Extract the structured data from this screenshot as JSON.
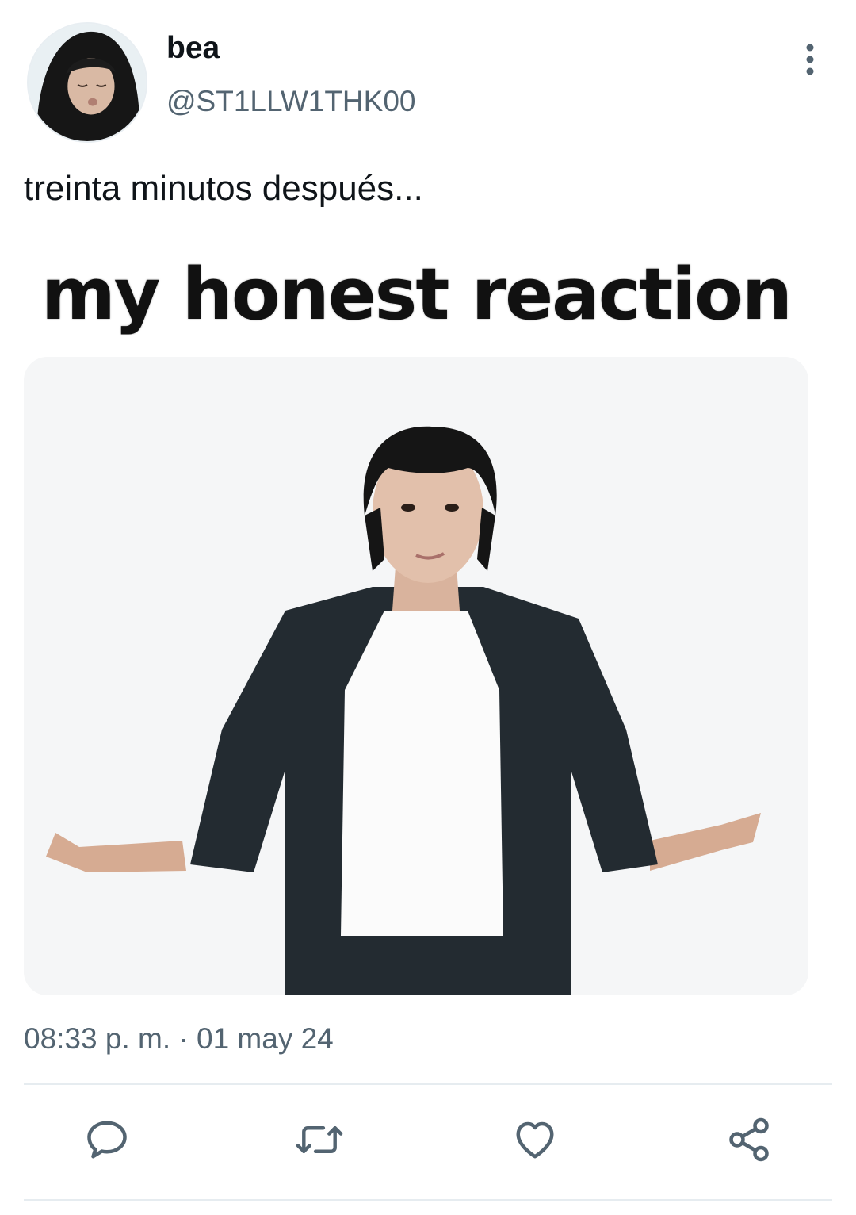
{
  "tweet": {
    "author": {
      "display_name": "bea",
      "handle": "@ST1LLW1THK00",
      "avatar_icon": "profile-photo"
    },
    "text": "treinta minutos después...",
    "media": {
      "caption": "my honest reaction"
    },
    "timestamp": "08:33 p. m. · 01 may 24"
  },
  "actions": [
    {
      "name": "reply",
      "icon": "speech-bubble-icon"
    },
    {
      "name": "retweet",
      "icon": "retweet-icon"
    },
    {
      "name": "like",
      "icon": "heart-icon"
    },
    {
      "name": "share",
      "icon": "share-icon"
    }
  ],
  "colors": {
    "primary_text": "#0f1419",
    "secondary_text": "#536471",
    "icon": "#536471",
    "divider": "#e6ecf0"
  }
}
